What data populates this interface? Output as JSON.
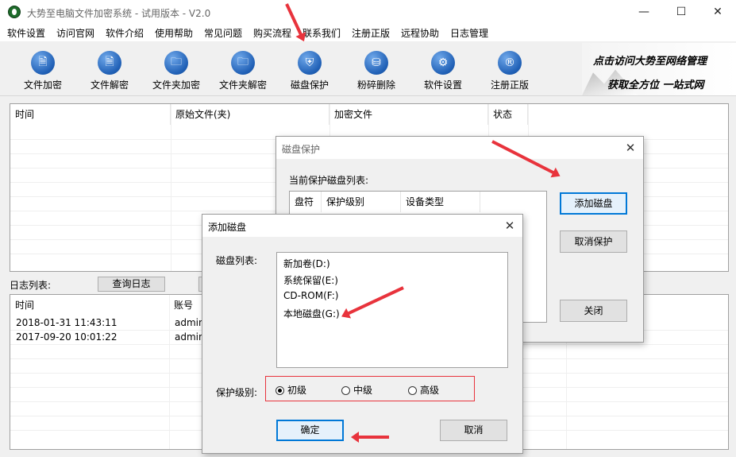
{
  "window": {
    "title": "大势至电脑文件加密系统 - 试用版本 - V2.0",
    "minimize": "—",
    "maximize": "☐",
    "close": "✕"
  },
  "menu": [
    "软件设置",
    "访问官网",
    "软件介绍",
    "使用帮助",
    "常见问题",
    "购买流程",
    "联系我们",
    "注册正版",
    "远程协助",
    "日志管理"
  ],
  "toolbar": [
    {
      "label": "文件加密",
      "icon": "file-lock-icon",
      "glyph": "🗎"
    },
    {
      "label": "文件解密",
      "icon": "file-unlock-icon",
      "glyph": "🗎"
    },
    {
      "label": "文件夹加密",
      "icon": "folder-lock-icon",
      "glyph": "🗀"
    },
    {
      "label": "文件夹解密",
      "icon": "folder-unlock-icon",
      "glyph": "🗀"
    },
    {
      "label": "磁盘保护",
      "icon": "disk-shield-icon",
      "glyph": "⛨"
    },
    {
      "label": "粉碎删除",
      "icon": "shred-icon",
      "glyph": "⛁"
    },
    {
      "label": "软件设置",
      "icon": "gear-icon",
      "glyph": "⚙"
    },
    {
      "label": "注册正版",
      "icon": "registered-icon",
      "glyph": "®"
    }
  ],
  "banner": {
    "line1": "点击访问大势至网络管理",
    "line2": "获取全方位 一站式网"
  },
  "file_table": {
    "headers": [
      "时间",
      "原始文件(夹)",
      "加密文件",
      "状态"
    ]
  },
  "log": {
    "label": "日志列表:",
    "query_button": "查询日志",
    "headers": [
      "时间",
      "账号"
    ],
    "rows": [
      {
        "time": "2018-01-31 11:43:11",
        "account": "admin"
      },
      {
        "time": "2017-09-20 10:01:22",
        "account": "admin"
      }
    ]
  },
  "disk_protect_dialog": {
    "title": "磁盘保护",
    "list_label": "当前保护磁盘列表:",
    "headers": [
      "盘符",
      "保护级别",
      "设备类型"
    ],
    "add_button": "添加磁盘",
    "cancel_button": "取消保护",
    "close_button": "关闭"
  },
  "add_disk_dialog": {
    "title": "添加磁盘",
    "list_label": "磁盘列表:",
    "disks": [
      "新加卷(D:)",
      "系统保留(E:)",
      "CD-ROM(F:)",
      "本地磁盘(G:)"
    ],
    "level_label": "保护级别:",
    "levels": [
      {
        "label": "初级",
        "selected": true
      },
      {
        "label": "中级",
        "selected": false
      },
      {
        "label": "高级",
        "selected": false
      }
    ],
    "ok_button": "确定",
    "cancel_button": "取消"
  },
  "colors": {
    "annotation_red": "#e8333c",
    "icon_blue": "#1f5fb5"
  }
}
